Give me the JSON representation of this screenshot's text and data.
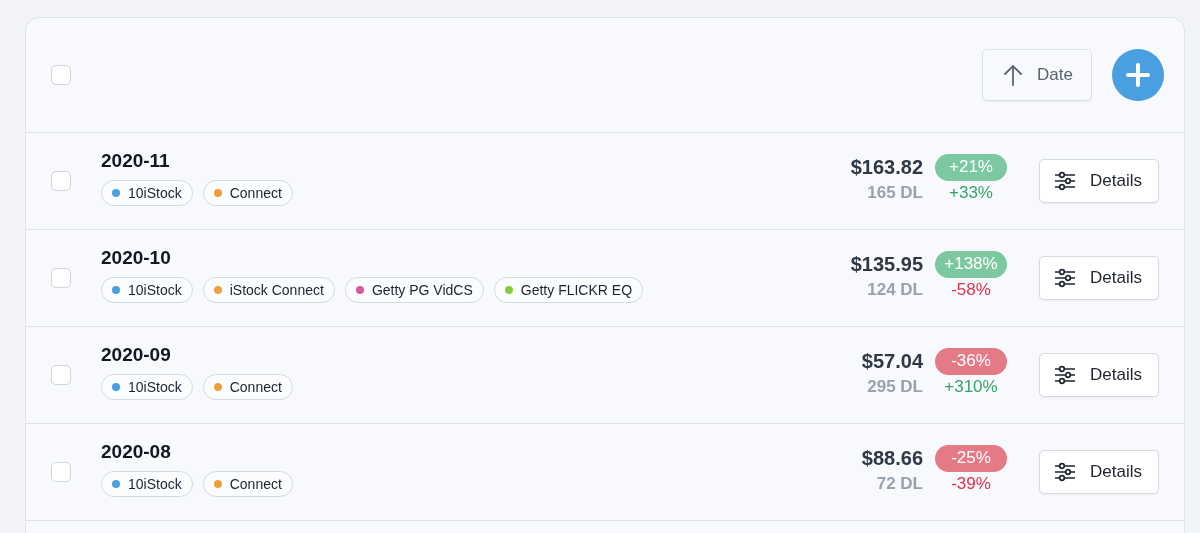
{
  "header": {
    "select_all": {
      "checked": false
    },
    "sort_button": {
      "label": "Date"
    }
  },
  "rows": [
    {
      "checked": false,
      "title": "2020-11",
      "tags": [
        {
          "label": "10iStock",
          "color": "#4a9fe0"
        },
        {
          "label": "Connect",
          "color": "#eea03c"
        }
      ],
      "amount": "$163.82",
      "change": "+21%",
      "change_positive": true,
      "downloads": "165 DL",
      "dl_change": "+33%",
      "dl_positive": true,
      "action": "Details"
    },
    {
      "checked": false,
      "title": "2020-10",
      "tags": [
        {
          "label": "10iStock",
          "color": "#4a9fe0"
        },
        {
          "label": "iStock Connect",
          "color": "#eea03c"
        },
        {
          "label": "Getty PG VidCS",
          "color": "#d9579a"
        },
        {
          "label": "Getty FLICKR EQ",
          "color": "#8ccb3c"
        }
      ],
      "amount": "$135.95",
      "change": "+138%",
      "change_positive": true,
      "downloads": "124 DL",
      "dl_change": "-58%",
      "dl_positive": false,
      "action": "Details"
    },
    {
      "checked": false,
      "title": "2020-09",
      "tags": [
        {
          "label": "10iStock",
          "color": "#4a9fe0"
        },
        {
          "label": "Connect",
          "color": "#eea03c"
        }
      ],
      "amount": "$57.04",
      "change": "-36%",
      "change_positive": false,
      "downloads": "295 DL",
      "dl_change": "+310%",
      "dl_positive": true,
      "action": "Details"
    },
    {
      "checked": false,
      "title": "2020-08",
      "tags": [
        {
          "label": "10iStock",
          "color": "#4a9fe0"
        },
        {
          "label": "Connect",
          "color": "#eea03c"
        }
      ],
      "amount": "$88.66",
      "change": "-25%",
      "change_positive": false,
      "downloads": "72 DL",
      "dl_change": "-39%",
      "dl_positive": false,
      "action": "Details"
    }
  ]
}
